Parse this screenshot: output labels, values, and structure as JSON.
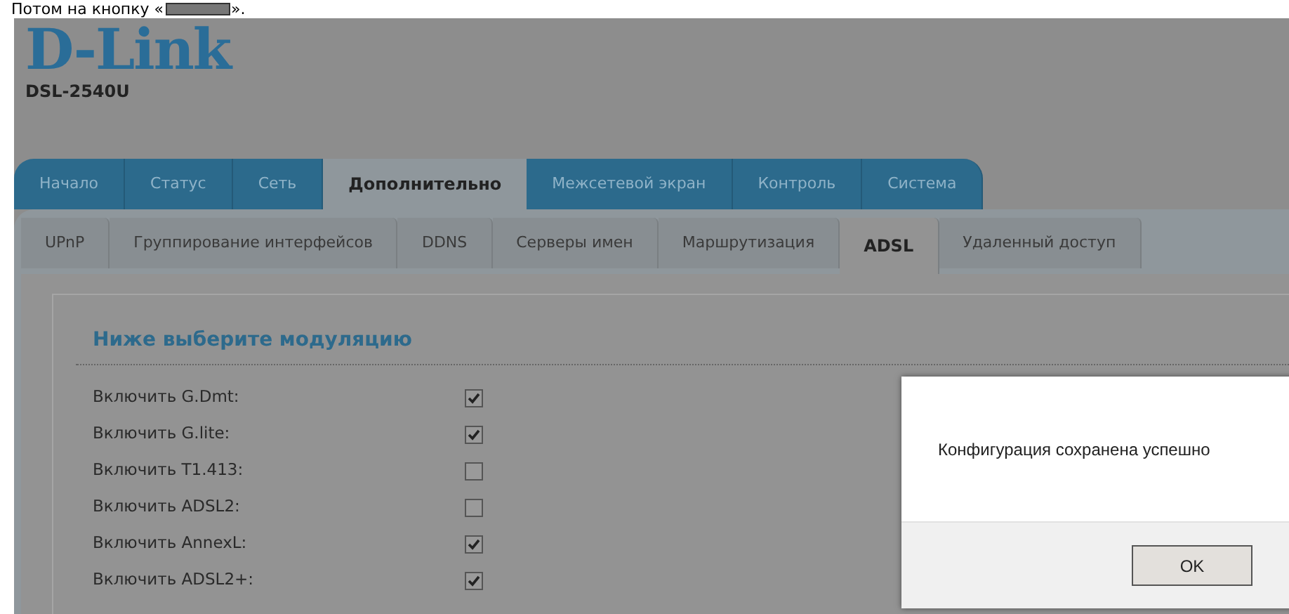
{
  "intro": {
    "before": "Потом на кнопку «",
    "after": "»."
  },
  "header": {
    "logo": "D-Link",
    "model": "DSL-2540U"
  },
  "main_tabs": [
    {
      "label": "Начало",
      "selected": false
    },
    {
      "label": "Статус",
      "selected": false
    },
    {
      "label": "Сеть",
      "selected": false
    },
    {
      "label": "Дополнительно",
      "selected": true
    },
    {
      "label": "Межсетевой экран",
      "selected": false
    },
    {
      "label": "Контроль",
      "selected": false
    },
    {
      "label": "Система",
      "selected": false
    }
  ],
  "sub_tabs": [
    {
      "label": "UPnP",
      "selected": false
    },
    {
      "label": "Группирование интерфейсов",
      "selected": false
    },
    {
      "label": "DDNS",
      "selected": false
    },
    {
      "label": "Серверы имен",
      "selected": false
    },
    {
      "label": "Маршрутизация",
      "selected": false
    },
    {
      "label": "ADSL",
      "selected": true
    },
    {
      "label": "Удаленный доступ",
      "selected": false
    }
  ],
  "section": {
    "title": "Ниже выберите модуляцию"
  },
  "options": [
    {
      "label": "Включить G.Dmt:",
      "checked": true
    },
    {
      "label": "Включить G.lite:",
      "checked": true
    },
    {
      "label": "Включить T1.413:",
      "checked": false
    },
    {
      "label": "Включить ADSL2:",
      "checked": false
    },
    {
      "label": "Включить AnnexL:",
      "checked": true
    },
    {
      "label": "Включить ADSL2+:",
      "checked": true
    }
  ],
  "dialog": {
    "message": "Конфигурация сохранена успешно",
    "button": "OK"
  }
}
